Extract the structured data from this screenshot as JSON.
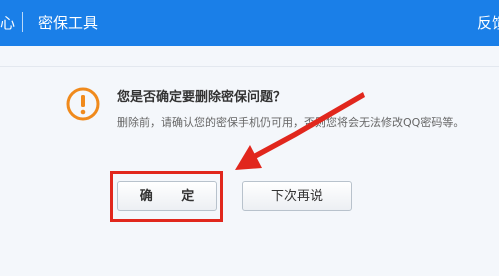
{
  "header": {
    "left_fragment": "心",
    "title": "密保工具",
    "right_fragment": "反馈"
  },
  "dialog": {
    "icon": "warning-icon",
    "question": "您是否确定要删除密保问题？",
    "description": "删除前，请确认您的密保手机仍可用，否则您将会无法修改QQ密码等。",
    "confirm_label": "确 定",
    "later_label": "下次再说"
  },
  "colors": {
    "header_bg": "#1a7fe8",
    "warning": "#f08a1c",
    "annotation": "#e1271d"
  }
}
